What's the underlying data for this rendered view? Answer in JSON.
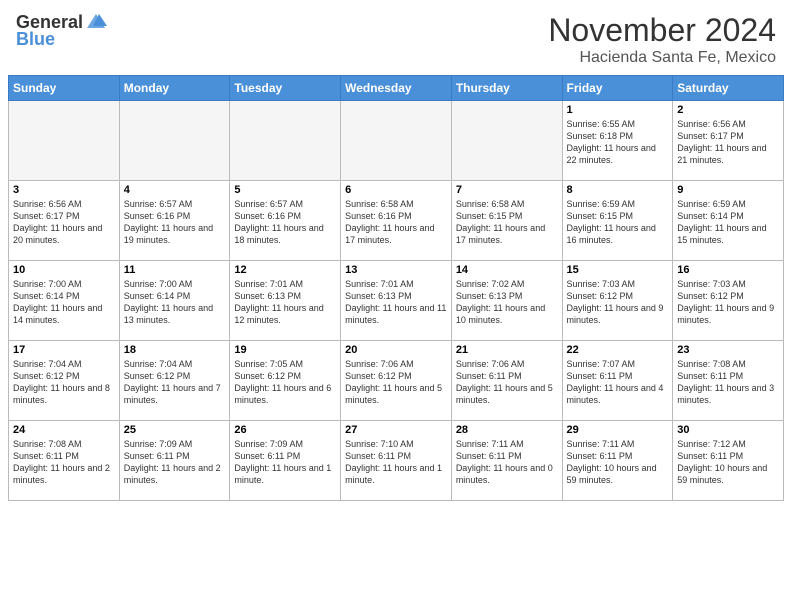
{
  "header": {
    "logo_general": "General",
    "logo_blue": "Blue",
    "month_year": "November 2024",
    "location": "Hacienda Santa Fe, Mexico"
  },
  "calendar": {
    "days_of_week": [
      "Sunday",
      "Monday",
      "Tuesday",
      "Wednesday",
      "Thursday",
      "Friday",
      "Saturday"
    ],
    "weeks": [
      [
        {
          "day": "",
          "info": ""
        },
        {
          "day": "",
          "info": ""
        },
        {
          "day": "",
          "info": ""
        },
        {
          "day": "",
          "info": ""
        },
        {
          "day": "",
          "info": ""
        },
        {
          "day": "1",
          "info": "Sunrise: 6:55 AM\nSunset: 6:18 PM\nDaylight: 11 hours and 22 minutes."
        },
        {
          "day": "2",
          "info": "Sunrise: 6:56 AM\nSunset: 6:17 PM\nDaylight: 11 hours and 21 minutes."
        }
      ],
      [
        {
          "day": "3",
          "info": "Sunrise: 6:56 AM\nSunset: 6:17 PM\nDaylight: 11 hours and 20 minutes."
        },
        {
          "day": "4",
          "info": "Sunrise: 6:57 AM\nSunset: 6:16 PM\nDaylight: 11 hours and 19 minutes."
        },
        {
          "day": "5",
          "info": "Sunrise: 6:57 AM\nSunset: 6:16 PM\nDaylight: 11 hours and 18 minutes."
        },
        {
          "day": "6",
          "info": "Sunrise: 6:58 AM\nSunset: 6:16 PM\nDaylight: 11 hours and 17 minutes."
        },
        {
          "day": "7",
          "info": "Sunrise: 6:58 AM\nSunset: 6:15 PM\nDaylight: 11 hours and 17 minutes."
        },
        {
          "day": "8",
          "info": "Sunrise: 6:59 AM\nSunset: 6:15 PM\nDaylight: 11 hours and 16 minutes."
        },
        {
          "day": "9",
          "info": "Sunrise: 6:59 AM\nSunset: 6:14 PM\nDaylight: 11 hours and 15 minutes."
        }
      ],
      [
        {
          "day": "10",
          "info": "Sunrise: 7:00 AM\nSunset: 6:14 PM\nDaylight: 11 hours and 14 minutes."
        },
        {
          "day": "11",
          "info": "Sunrise: 7:00 AM\nSunset: 6:14 PM\nDaylight: 11 hours and 13 minutes."
        },
        {
          "day": "12",
          "info": "Sunrise: 7:01 AM\nSunset: 6:13 PM\nDaylight: 11 hours and 12 minutes."
        },
        {
          "day": "13",
          "info": "Sunrise: 7:01 AM\nSunset: 6:13 PM\nDaylight: 11 hours and 11 minutes."
        },
        {
          "day": "14",
          "info": "Sunrise: 7:02 AM\nSunset: 6:13 PM\nDaylight: 11 hours and 10 minutes."
        },
        {
          "day": "15",
          "info": "Sunrise: 7:03 AM\nSunset: 6:12 PM\nDaylight: 11 hours and 9 minutes."
        },
        {
          "day": "16",
          "info": "Sunrise: 7:03 AM\nSunset: 6:12 PM\nDaylight: 11 hours and 9 minutes."
        }
      ],
      [
        {
          "day": "17",
          "info": "Sunrise: 7:04 AM\nSunset: 6:12 PM\nDaylight: 11 hours and 8 minutes."
        },
        {
          "day": "18",
          "info": "Sunrise: 7:04 AM\nSunset: 6:12 PM\nDaylight: 11 hours and 7 minutes."
        },
        {
          "day": "19",
          "info": "Sunrise: 7:05 AM\nSunset: 6:12 PM\nDaylight: 11 hours and 6 minutes."
        },
        {
          "day": "20",
          "info": "Sunrise: 7:06 AM\nSunset: 6:12 PM\nDaylight: 11 hours and 5 minutes."
        },
        {
          "day": "21",
          "info": "Sunrise: 7:06 AM\nSunset: 6:11 PM\nDaylight: 11 hours and 5 minutes."
        },
        {
          "day": "22",
          "info": "Sunrise: 7:07 AM\nSunset: 6:11 PM\nDaylight: 11 hours and 4 minutes."
        },
        {
          "day": "23",
          "info": "Sunrise: 7:08 AM\nSunset: 6:11 PM\nDaylight: 11 hours and 3 minutes."
        }
      ],
      [
        {
          "day": "24",
          "info": "Sunrise: 7:08 AM\nSunset: 6:11 PM\nDaylight: 11 hours and 2 minutes."
        },
        {
          "day": "25",
          "info": "Sunrise: 7:09 AM\nSunset: 6:11 PM\nDaylight: 11 hours and 2 minutes."
        },
        {
          "day": "26",
          "info": "Sunrise: 7:09 AM\nSunset: 6:11 PM\nDaylight: 11 hours and 1 minute."
        },
        {
          "day": "27",
          "info": "Sunrise: 7:10 AM\nSunset: 6:11 PM\nDaylight: 11 hours and 1 minute."
        },
        {
          "day": "28",
          "info": "Sunrise: 7:11 AM\nSunset: 6:11 PM\nDaylight: 11 hours and 0 minutes."
        },
        {
          "day": "29",
          "info": "Sunrise: 7:11 AM\nSunset: 6:11 PM\nDaylight: 10 hours and 59 minutes."
        },
        {
          "day": "30",
          "info": "Sunrise: 7:12 AM\nSunset: 6:11 PM\nDaylight: 10 hours and 59 minutes."
        }
      ]
    ]
  }
}
